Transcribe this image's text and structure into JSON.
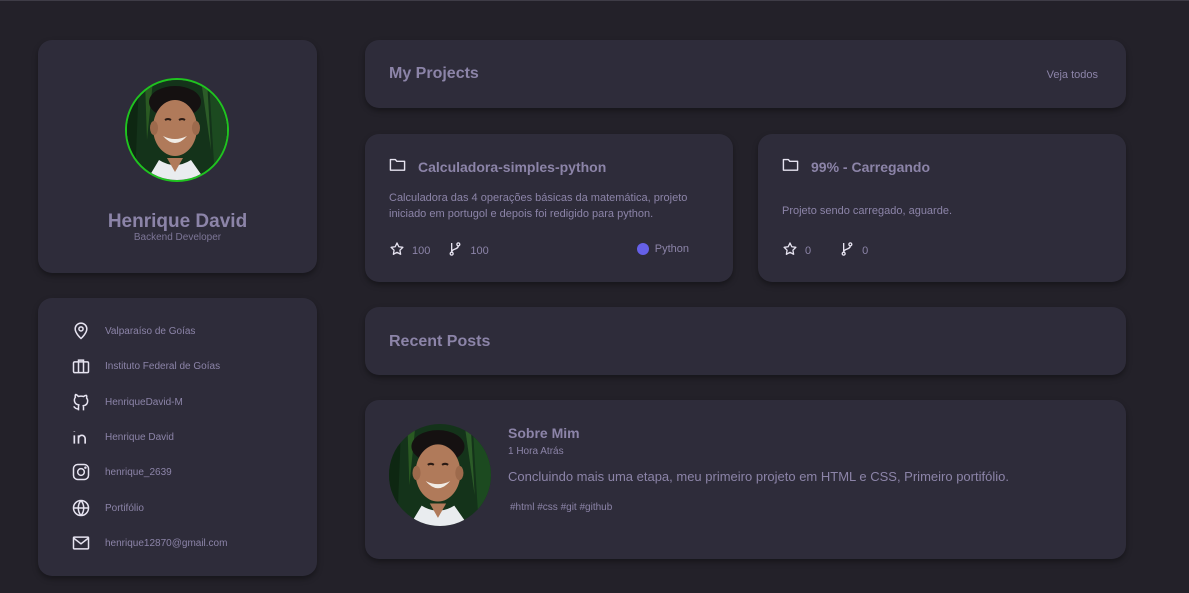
{
  "profile": {
    "name": "Henrique David",
    "role": "Backend Developer"
  },
  "contacts": [
    {
      "icon": "location-pin-icon",
      "label": "Valparaíso de Goías"
    },
    {
      "icon": "briefcase-icon",
      "label": "Instituto Federal de Goías"
    },
    {
      "icon": "github-icon",
      "label": "HenriqueDavid-M"
    },
    {
      "icon": "linkedin-icon",
      "label": "Henrique David"
    },
    {
      "icon": "instagram-icon",
      "label": "henrique_2639"
    },
    {
      "icon": "globe-icon",
      "label": "Portifólio"
    },
    {
      "icon": "mail-icon",
      "label": "henrique12870@gmail.com"
    }
  ],
  "projects": {
    "title": "My Projects",
    "see_all": "Veja todos",
    "items": [
      {
        "icon": "folder-icon",
        "name": "Calculadora-simples-python",
        "description": "Calculadora das 4 operações básicas da matemática, projeto iniciado em portugol e depois foi redigido para python.",
        "stars": "100",
        "forks": "100",
        "language": "Python",
        "language_color": "#6560e8"
      },
      {
        "icon": "folder-icon",
        "name": "99% - Carregando",
        "description": "Projeto sendo carregado, aguarde.",
        "stars": "0",
        "forks": "0"
      }
    ]
  },
  "posts": {
    "title": "Recent Posts",
    "items": [
      {
        "title": "Sobre Mim",
        "time": "1 Hora Atrás",
        "text": "Concluindo mais uma etapa, meu primeiro projeto em HTML e CSS, Primeiro portifólio.",
        "tags": "#html #css #git #github"
      }
    ]
  },
  "colors": {
    "background": "#232129",
    "card": "#2e2c3a",
    "text": "#8c84a8",
    "avatar_ring": "#1fc41f"
  }
}
